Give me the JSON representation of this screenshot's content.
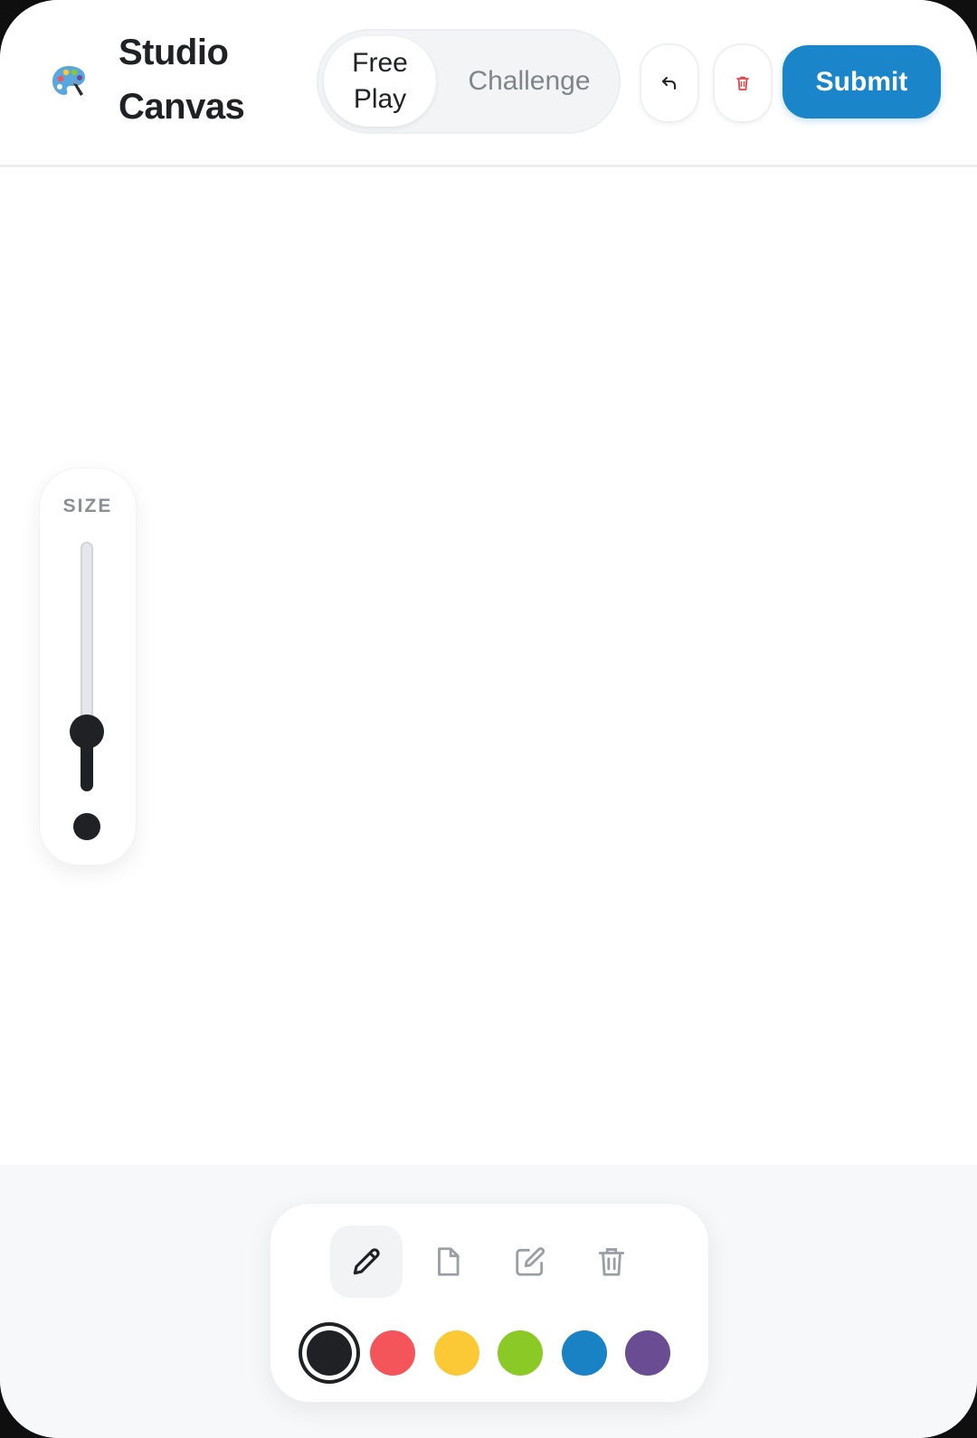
{
  "header": {
    "logo_icon": "palette-icon",
    "title": "Studio Canvas",
    "modes": [
      {
        "label": "Free Play",
        "active": true
      },
      {
        "label": "Challenge",
        "active": false
      }
    ],
    "undo_icon": "undo-icon",
    "clear_icon": "trash-icon",
    "submit_label": "Submit"
  },
  "size_panel": {
    "label": "SIZE",
    "value_fraction": 0.24
  },
  "toolbar": {
    "tools": [
      {
        "name": "pencil",
        "icon": "pencil-icon",
        "active": true
      },
      {
        "name": "page",
        "icon": "document-icon",
        "active": false
      },
      {
        "name": "edit",
        "icon": "edit-icon",
        "active": false
      },
      {
        "name": "delete",
        "icon": "trash-icon",
        "active": false
      }
    ],
    "colors": [
      {
        "name": "black",
        "hex": "#1f2124",
        "selected": true
      },
      {
        "name": "red",
        "hex": "#f4555a",
        "selected": false
      },
      {
        "name": "yellow",
        "hex": "#fcc936",
        "selected": false
      },
      {
        "name": "green",
        "hex": "#8ac926",
        "selected": false
      },
      {
        "name": "blue",
        "hex": "#1982c4",
        "selected": false
      },
      {
        "name": "purple",
        "hex": "#6a4c93",
        "selected": false
      }
    ]
  },
  "colors": {
    "accent": "#1a85c8",
    "danger": "#e0454b"
  }
}
